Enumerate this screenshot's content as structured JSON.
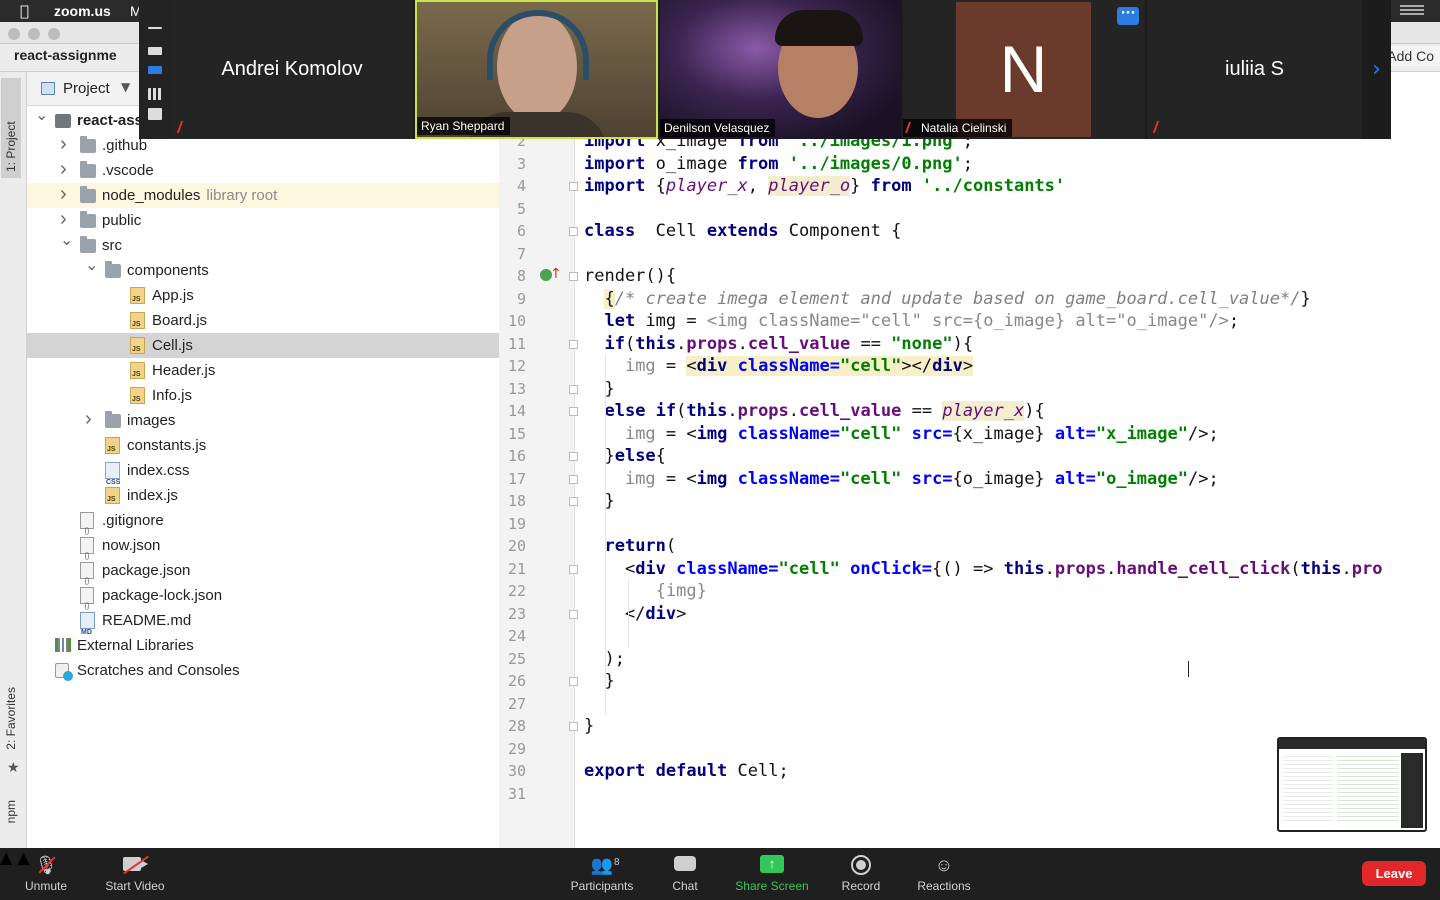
{
  "menubar": {
    "apple": "",
    "app": "zoom.us",
    "menu2": "M"
  },
  "ide": {
    "window_tab": "react-assignme",
    "add_config": "Add Co",
    "project_tool": "Project",
    "strip": {
      "project": "1: Project",
      "favorites": "2: Favorites",
      "npm": "npm"
    },
    "tree": [
      {
        "label": "react-ass",
        "kind": "root",
        "level": 0,
        "arrow": "down",
        "bold": true
      },
      {
        "label": ".github",
        "kind": "folder",
        "level": 1,
        "arrow": "right"
      },
      {
        "label": ".vscode",
        "kind": "folder",
        "level": 1,
        "arrow": "right"
      },
      {
        "label": "node_modules",
        "hint": "library root",
        "kind": "folder",
        "level": 1,
        "arrow": "right",
        "lib": true
      },
      {
        "label": "public",
        "kind": "folder",
        "level": 1,
        "arrow": "right"
      },
      {
        "label": "src",
        "kind": "folder",
        "level": 1,
        "arrow": "down"
      },
      {
        "label": "components",
        "kind": "folder",
        "level": 2,
        "arrow": "down"
      },
      {
        "label": "App.js",
        "kind": "js",
        "level": 3
      },
      {
        "label": "Board.js",
        "kind": "js",
        "level": 3
      },
      {
        "label": "Cell.js",
        "kind": "js",
        "level": 3,
        "selected": true
      },
      {
        "label": "Header.js",
        "kind": "js",
        "level": 3
      },
      {
        "label": "Info.js",
        "kind": "js",
        "level": 3
      },
      {
        "label": "images",
        "kind": "folder",
        "level": 2,
        "arrow": "right"
      },
      {
        "label": "constants.js",
        "kind": "js",
        "level": 2
      },
      {
        "label": "index.css",
        "kind": "css",
        "level": 2
      },
      {
        "label": "index.js",
        "kind": "js",
        "level": 2
      },
      {
        "label": ".gitignore",
        "kind": "gen",
        "level": 1
      },
      {
        "label": "now.json",
        "kind": "gen",
        "level": 1
      },
      {
        "label": "package.json",
        "kind": "gen",
        "level": 1
      },
      {
        "label": "package-lock.json",
        "kind": "gen",
        "level": 1
      },
      {
        "label": "README.md",
        "kind": "md",
        "level": 1
      },
      {
        "label": "External Libraries",
        "kind": "libs",
        "level": 0
      },
      {
        "label": "Scratches and Consoles",
        "kind": "scr",
        "level": 0
      }
    ],
    "line_numbers": [
      "2",
      "3",
      "4",
      "5",
      "6",
      "7",
      "8",
      "9",
      "10",
      "11",
      "12",
      "13",
      "14",
      "15",
      "16",
      "17",
      "18",
      "19",
      "20",
      "21",
      "22",
      "23",
      "24",
      "25",
      "26",
      "27",
      "28",
      "29",
      "30",
      "31"
    ]
  },
  "code_lines": [
    [
      {
        "t": "import ",
        "c": "kw"
      },
      {
        "t": "x_image "
      },
      {
        "t": "from ",
        "c": "kw"
      },
      {
        "t": "'../images/1.png'",
        "c": "str"
      },
      {
        "t": ";"
      }
    ],
    [
      {
        "t": "import ",
        "c": "kw"
      },
      {
        "t": "o_image "
      },
      {
        "t": "from ",
        "c": "kw"
      },
      {
        "t": "'../images/0.png'",
        "c": "str"
      },
      {
        "t": ";"
      }
    ],
    [
      {
        "t": "import ",
        "c": "kw"
      },
      {
        "t": "{"
      },
      {
        "t": "player_x",
        "c": "ivar"
      },
      {
        "t": ", "
      },
      {
        "t": "player_o",
        "c": "ivar hl2"
      },
      {
        "t": "} "
      },
      {
        "t": "from ",
        "c": "kw"
      },
      {
        "t": "'../constants'",
        "c": "str"
      }
    ],
    [],
    [
      {
        "t": "class  ",
        "c": "kw"
      },
      {
        "t": "Cell "
      },
      {
        "t": "extends ",
        "c": "kw"
      },
      {
        "t": "Component {"
      }
    ],
    [],
    [
      {
        "t": "render(){"
      }
    ],
    [
      {
        "t": "  "
      },
      {
        "t": "{",
        "c": "hl"
      },
      {
        "t": "/* create imega element and update based on game_board.cell_value*/",
        "c": "cmt"
      },
      {
        "t": "}"
      }
    ],
    [
      {
        "t": "  "
      },
      {
        "t": "let ",
        "c": "kw"
      },
      {
        "t": "img "
      },
      {
        "t": "= "
      },
      {
        "t": "<img className=\"cell\" src={o_image} alt=\"o_image\"/>",
        "c": "gry"
      },
      {
        "t": ";"
      }
    ],
    [
      {
        "t": "  "
      },
      {
        "t": "if",
        "c": "kw"
      },
      {
        "t": "("
      },
      {
        "t": "this",
        "c": "kw"
      },
      {
        "t": "."
      },
      {
        "t": "props",
        "c": "prop"
      },
      {
        "t": "."
      },
      {
        "t": "cell_value",
        "c": "prop"
      },
      {
        "t": " == "
      },
      {
        "t": "\"none\"",
        "c": "str"
      },
      {
        "t": "){"
      }
    ],
    [
      {
        "t": "    "
      },
      {
        "t": "img",
        "c": "gry"
      },
      {
        "t": " = "
      },
      {
        "t": "<",
        "c": "hl"
      },
      {
        "t": "div ",
        "c": "tag hl"
      },
      {
        "t": "className=",
        "c": "attr hl"
      },
      {
        "t": "\"cell\"",
        "c": "str hl"
      },
      {
        "t": "></",
        "c": "hl"
      },
      {
        "t": "div",
        "c": "tag hl"
      },
      {
        "t": ">",
        "c": "hl"
      }
    ],
    [
      {
        "t": "  }"
      }
    ],
    [
      {
        "t": "  "
      },
      {
        "t": "else if",
        "c": "kw"
      },
      {
        "t": "("
      },
      {
        "t": "this",
        "c": "kw"
      },
      {
        "t": "."
      },
      {
        "t": "props",
        "c": "prop"
      },
      {
        "t": "."
      },
      {
        "t": "cell_value",
        "c": "prop"
      },
      {
        "t": " == "
      },
      {
        "t": "player_x",
        "c": "ivar hl2"
      },
      {
        "t": "){"
      }
    ],
    [
      {
        "t": "    "
      },
      {
        "t": "img",
        "c": "gry"
      },
      {
        "t": " = <"
      },
      {
        "t": "img ",
        "c": "tag"
      },
      {
        "t": "className=",
        "c": "attr"
      },
      {
        "t": "\"cell\" ",
        "c": "str"
      },
      {
        "t": "src=",
        "c": "attr"
      },
      {
        "t": "{x_image} "
      },
      {
        "t": "alt=",
        "c": "attr"
      },
      {
        "t": "\"x_image\"",
        "c": "str"
      },
      {
        "t": "/>;"
      }
    ],
    [
      {
        "t": "  }"
      },
      {
        "t": "else",
        "c": "kw"
      },
      {
        "t": "{"
      }
    ],
    [
      {
        "t": "    "
      },
      {
        "t": "img",
        "c": "gry"
      },
      {
        "t": " = <"
      },
      {
        "t": "img ",
        "c": "tag"
      },
      {
        "t": "className=",
        "c": "attr"
      },
      {
        "t": "\"cell\" ",
        "c": "str"
      },
      {
        "t": "src=",
        "c": "attr"
      },
      {
        "t": "{o_image} "
      },
      {
        "t": "alt=",
        "c": "attr"
      },
      {
        "t": "\"o_image\"",
        "c": "str"
      },
      {
        "t": "/>;"
      }
    ],
    [
      {
        "t": "  }"
      }
    ],
    [],
    [
      {
        "t": "  "
      },
      {
        "t": "return",
        "c": "kw"
      },
      {
        "t": "("
      }
    ],
    [
      {
        "t": "    <"
      },
      {
        "t": "div ",
        "c": "tag"
      },
      {
        "t": "className=",
        "c": "attr"
      },
      {
        "t": "\"cell\" ",
        "c": "str"
      },
      {
        "t": "onClick=",
        "c": "attr"
      },
      {
        "t": "{() => "
      },
      {
        "t": "this",
        "c": "kw"
      },
      {
        "t": "."
      },
      {
        "t": "props",
        "c": "prop"
      },
      {
        "t": "."
      },
      {
        "t": "handle_cell_click",
        "c": "prop"
      },
      {
        "t": "("
      },
      {
        "t": "this",
        "c": "kw"
      },
      {
        "t": "."
      },
      {
        "t": "pro",
        "c": "prop"
      }
    ],
    [
      {
        "t": "       "
      },
      {
        "t": "{img}",
        "c": "gry"
      }
    ],
    [
      {
        "t": "    </"
      },
      {
        "t": "div",
        "c": "tag"
      },
      {
        "t": ">"
      }
    ],
    [],
    [
      {
        "t": "  );"
      }
    ],
    [
      {
        "t": "  }"
      }
    ],
    [],
    [
      {
        "t": "}"
      }
    ],
    [],
    [
      {
        "t": "export default ",
        "c": "kw"
      },
      {
        "t": "Cell;"
      }
    ],
    []
  ],
  "zoom": {
    "participants": [
      {
        "name": "Andrei Komolov",
        "label": "",
        "muted": true,
        "video": false
      },
      {
        "name": "Ryan Sheppard",
        "label": "Ryan Sheppard",
        "muted": false,
        "video": true,
        "active": true
      },
      {
        "name": "Denilson Velasquez",
        "label": "Denilson Velasquez",
        "muted": false,
        "video": true
      },
      {
        "name": "Natalia Cielinski",
        "label": "Natalia Cielinski",
        "muted": true,
        "video": false,
        "initial": "N"
      },
      {
        "name": "iuliia S",
        "label": "",
        "muted": true,
        "video": false
      }
    ],
    "more_button": "···",
    "next_arrow": "›",
    "toolbar": {
      "unmute": "Unmute",
      "start_video": "Start Video",
      "participants": "Participants",
      "participants_count": "8",
      "chat": "Chat",
      "share_screen": "Share Screen",
      "record": "Record",
      "reactions": "Reactions",
      "leave": "Leave"
    },
    "colors": {
      "share_green": "#34c759",
      "leave_red": "#e02828",
      "active_speaker": "#c9e34a"
    }
  }
}
